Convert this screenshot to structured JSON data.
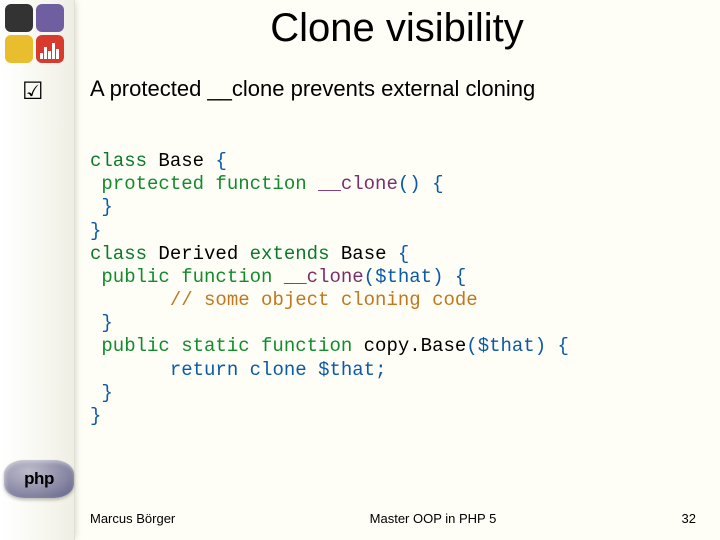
{
  "title": "Clone visibility",
  "bullet": "A protected __clone prevents external cloning",
  "php_badge": "php",
  "code": {
    "l1a": "class",
    "l1b": "Base",
    "l1c": "{",
    "l2a": "protected function",
    "l2b": "__clone",
    "l2c": "()",
    "l2d": "{",
    "l3a": "}",
    "l4a": "}",
    "l5a": "class",
    "l5b": "Derived",
    "l5c": "extends",
    "l5d": "Base",
    "l5e": "{",
    "l6a": "public function",
    "l6b": "__clone",
    "l6c": "(",
    "l6d": "$that",
    "l6e": ")",
    "l6f": "{",
    "l7a": "// some object cloning code",
    "l8a": "}",
    "l9a": "public static function",
    "l9b": "copy.Base",
    "l9c": "(",
    "l9d": "$that",
    "l9e": ")",
    "l9f": "{",
    "l10a": "return",
    "l10b": "clone",
    "l10c": "$that",
    "l10d": ";",
    "l11a": "}",
    "l12a": "}"
  },
  "footer": {
    "author": "Marcus Börger",
    "course": "Master OOP in PHP 5",
    "page": "32"
  },
  "icons": {
    "check": "☑"
  }
}
